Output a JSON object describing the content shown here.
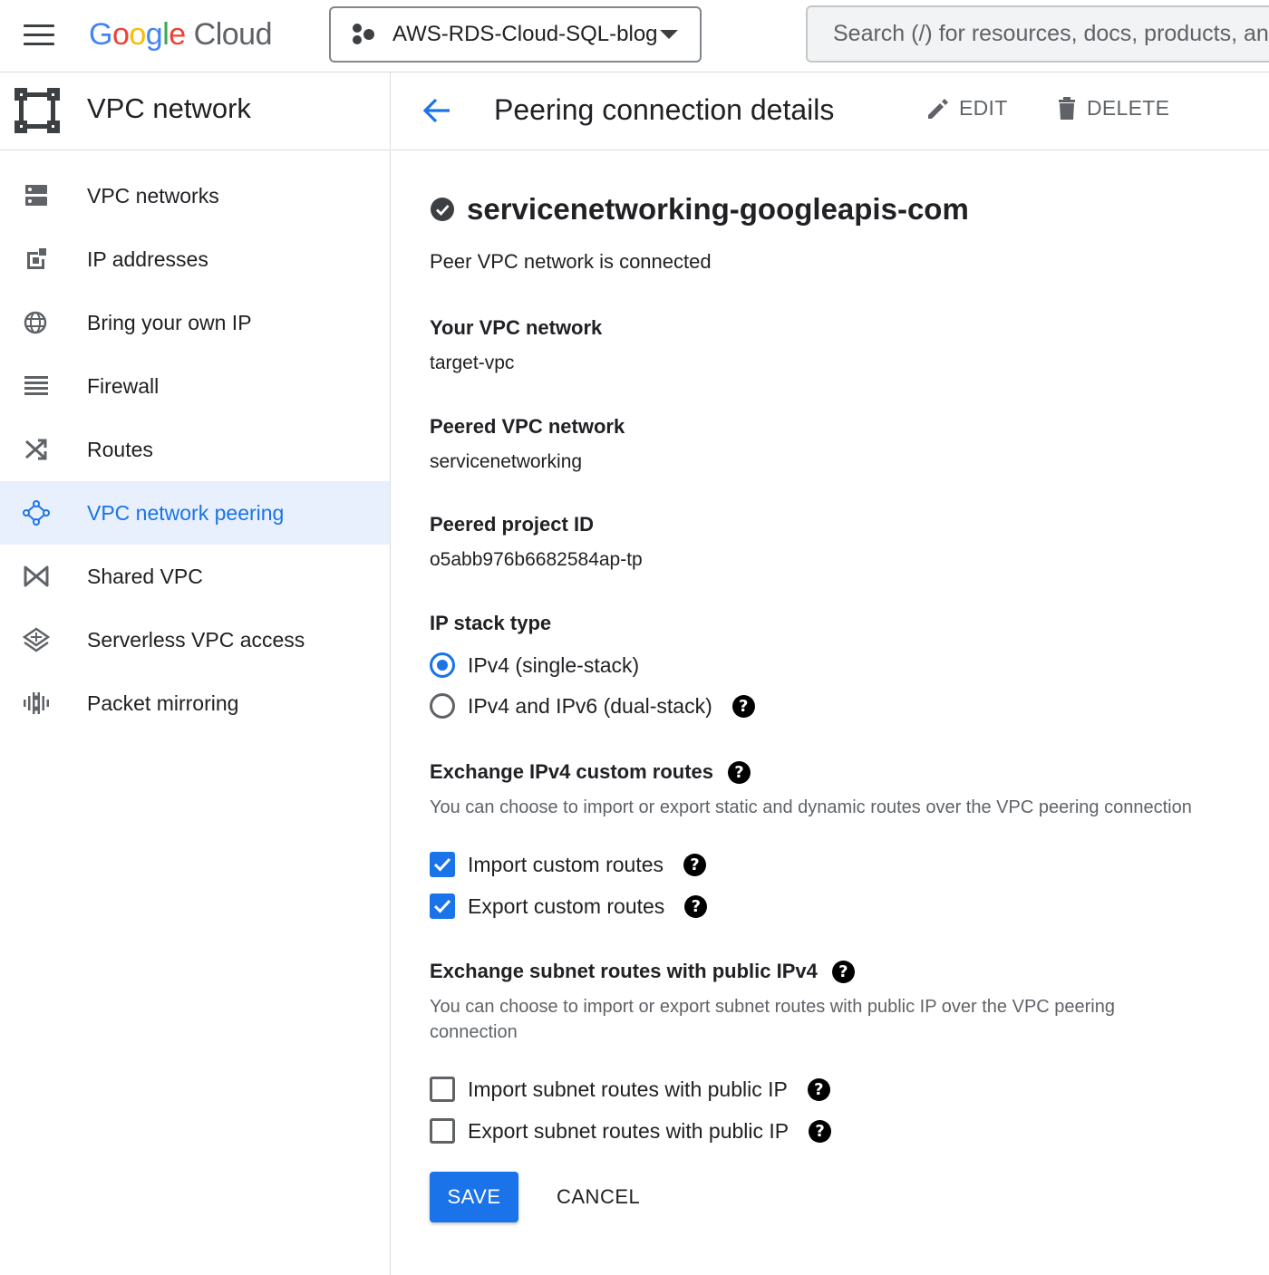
{
  "topbar": {
    "logo": {
      "g1": "G",
      "o1": "o",
      "o2": "o",
      "g2": "g",
      "l": "l",
      "e": "e",
      "cloud": "Cloud"
    },
    "project": "AWS-RDS-Cloud-SQL-blog",
    "search_placeholder": "Search (/) for resources, docs, products, and more"
  },
  "sidebar": {
    "title": "VPC network",
    "items": [
      {
        "label": "VPC networks",
        "icon": "vpc-networks-icon",
        "active": false
      },
      {
        "label": "IP addresses",
        "icon": "ip-addresses-icon",
        "active": false
      },
      {
        "label": "Bring your own IP",
        "icon": "globe-icon",
        "active": false
      },
      {
        "label": "Firewall",
        "icon": "firewall-icon",
        "active": false
      },
      {
        "label": "Routes",
        "icon": "routes-icon",
        "active": false
      },
      {
        "label": "VPC network peering",
        "icon": "peering-icon",
        "active": true
      },
      {
        "label": "Shared VPC",
        "icon": "shared-vpc-icon",
        "active": false
      },
      {
        "label": "Serverless VPC access",
        "icon": "serverless-icon",
        "active": false
      },
      {
        "label": "Packet mirroring",
        "icon": "packet-mirroring-icon",
        "active": false
      }
    ]
  },
  "header": {
    "title": "Peering connection details",
    "edit_label": "EDIT",
    "delete_label": "DELETE"
  },
  "details": {
    "name": "servicenetworking-googleapis-com",
    "status": "Peer VPC network is connected",
    "your_vpc_label": "Your VPC network",
    "your_vpc_value": "target-vpc",
    "peered_vpc_label": "Peered VPC network",
    "peered_vpc_value": "servicenetworking",
    "peered_project_label": "Peered project ID",
    "peered_project_value": "o5abb976b6682584ap-tp"
  },
  "ip_stack": {
    "label": "IP stack type",
    "options": [
      {
        "label": "IPv4 (single-stack)",
        "selected": true
      },
      {
        "label": "IPv4 and IPv6 (dual-stack)",
        "selected": false
      }
    ]
  },
  "custom_routes": {
    "label": "Exchange IPv4 custom routes",
    "description": "You can choose to import or export static and dynamic routes over the VPC peering connection",
    "options": [
      {
        "label": "Import custom routes",
        "checked": true
      },
      {
        "label": "Export custom routes",
        "checked": true
      }
    ]
  },
  "subnet_routes": {
    "label": "Exchange subnet routes with public IPv4",
    "description": "You can choose to import or export subnet routes with public IP over the VPC peering connection",
    "options": [
      {
        "label": "Import subnet routes with public IP",
        "checked": false
      },
      {
        "label": "Export subnet routes with public IP",
        "checked": false
      }
    ]
  },
  "help_glyph": "?",
  "actions": {
    "save": "SAVE",
    "cancel": "CANCEL"
  },
  "colors": {
    "accent": "#1a73e8",
    "active_bg": "#e8f0fe",
    "text": "#202124",
    "muted": "#5f6368"
  }
}
